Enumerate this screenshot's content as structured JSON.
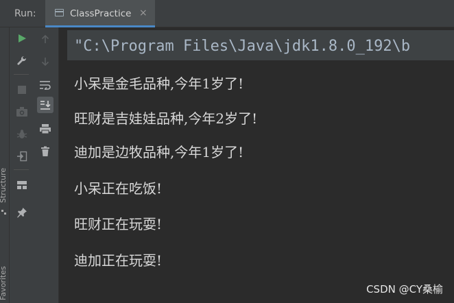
{
  "run_panel": {
    "label": "Run:",
    "tab": {
      "title": "ClassPractice",
      "close_glyph": "×"
    }
  },
  "side_panels": {
    "structure_label": "Structure",
    "favorites_label": "Favorites"
  },
  "toolbar": {
    "left_column": [
      "rerun-icon",
      "wrench-icon",
      "stop-icon",
      "camera-icon",
      "debug-bug-icon",
      "exit-icon",
      "layout-icon",
      "pin-icon"
    ],
    "right_column": [
      "arrow-up-icon",
      "arrow-down-icon",
      "soft-wrap-icon",
      "scroll-to-end-icon",
      "print-icon",
      "trash-icon"
    ]
  },
  "console": {
    "command_line": "\"C:\\Program Files\\Java\\jdk1.8.0_192\\b",
    "output_lines": [
      "小呆是金毛品种,今年1岁了!",
      "旺财是吉娃娃品种,今年2岁了!",
      "迪加是边牧品种,今年1岁了!",
      "小呆正在吃饭!",
      "旺财正在玩耍!",
      "迪加正在玩耍!"
    ]
  },
  "watermark": "CSDN @CY桑榆",
  "colors": {
    "background": "#2b2b2b",
    "panel": "#3c3f41",
    "accent": "#4a88c7",
    "run_green": "#59a869",
    "text": "#d8d8d8"
  }
}
